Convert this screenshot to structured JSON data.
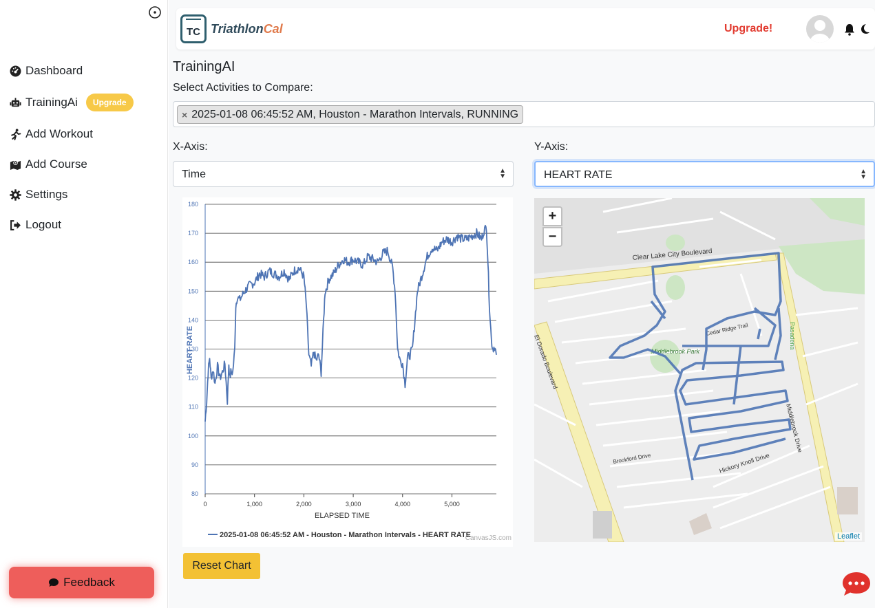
{
  "sidebar": {
    "items": [
      {
        "label": "Dashboard",
        "icon": "dashboard-icon"
      },
      {
        "label": "TrainingAi",
        "icon": "robot-icon",
        "badge": "Upgrade"
      },
      {
        "label": "Add Workout",
        "icon": "running-icon"
      },
      {
        "label": "Add Course",
        "icon": "map-icon"
      },
      {
        "label": "Settings",
        "icon": "gear-icon"
      },
      {
        "label": "Logout",
        "icon": "logout-icon"
      }
    ],
    "feedback_label": "Feedback"
  },
  "header": {
    "logo_mark": "TC",
    "logo_text_a": "Triathlon",
    "logo_text_b": "Cal",
    "upgrade_label": "Upgrade!"
  },
  "page": {
    "title": "TrainingAI",
    "select_label": "Select Activities to Compare:",
    "selected_activity": "2025-01-08 06:45:52 AM, Houston - Marathon Intervals, RUNNING",
    "xaxis_label": "X-Axis:",
    "xaxis_value": "Time",
    "yaxis_label": "Y-Axis:",
    "yaxis_value": "HEART RATE",
    "reset_label": "Reset Chart"
  },
  "map": {
    "zoom_in": "+",
    "zoom_out": "−",
    "attribution": "Leaflet",
    "street_labels": [
      "Clear Lake City Boulevard",
      "El Dorado Boulevard",
      "Middlebrook Drive",
      "Middlebrook Park",
      "Cedar Ridge Trail",
      "Hickory Knoll Drive",
      "Brookford Drive",
      "Pasadena"
    ]
  },
  "colors": {
    "accent": "#f7c948",
    "upgrade_red": "#e23b30",
    "series": "#4e74b4",
    "feedback": "#ee5e5b"
  },
  "chart_data": {
    "type": "line",
    "xlabel": "ELAPSED TIME",
    "ylabel": "HEART RATE",
    "xlim": [
      0,
      5900
    ],
    "ylim": [
      80,
      180
    ],
    "xticks": [
      0,
      1000,
      2000,
      3000,
      4000,
      5000
    ],
    "xtick_labels": [
      "0",
      "1,000",
      "2,000",
      "3,000",
      "4,000",
      "5,000"
    ],
    "yticks": [
      80,
      90,
      100,
      110,
      120,
      130,
      140,
      150,
      160,
      170,
      180
    ],
    "credit": "CanvasJS.com",
    "series": [
      {
        "name": "2025-01-08 06:45:52 AM - Houston - Marathon Intervals - HEART RATE",
        "x": [
          0,
          30,
          60,
          90,
          120,
          160,
          200,
          250,
          300,
          350,
          400,
          450,
          480,
          500,
          520,
          560,
          600,
          620,
          650,
          700,
          800,
          900,
          1000,
          1100,
          1200,
          1300,
          1400,
          1500,
          1600,
          1700,
          1800,
          1900,
          2000,
          2050,
          2100,
          2150,
          2200,
          2250,
          2300,
          2350,
          2400,
          2430,
          2460,
          2500,
          2550,
          2600,
          2700,
          2800,
          2900,
          3000,
          3100,
          3200,
          3300,
          3400,
          3500,
          3600,
          3700,
          3800,
          3850,
          3900,
          3950,
          4000,
          4050,
          4100,
          4150,
          4200,
          4250,
          4300,
          4350,
          4400,
          4500,
          4600,
          4700,
          4800,
          4900,
          5000,
          5100,
          5200,
          5300,
          5400,
          5500,
          5600,
          5650,
          5700,
          5730,
          5760,
          5800,
          5830,
          5860,
          5900
        ],
        "y": [
          105,
          112,
          122,
          127,
          120,
          123,
          118,
          124,
          120,
          122,
          125,
          112,
          125,
          120,
          122,
          122,
          130,
          145,
          148,
          147,
          150,
          152,
          153,
          156,
          155,
          157,
          156,
          155,
          157,
          154,
          157,
          158,
          155,
          145,
          128,
          124,
          129,
          126,
          128,
          122,
          140,
          150,
          151,
          154,
          155,
          156,
          159,
          161,
          160,
          161,
          160,
          159,
          162,
          161,
          160,
          163,
          164,
          158,
          150,
          130,
          126,
          125,
          118,
          127,
          128,
          130,
          140,
          150,
          153,
          156,
          162,
          165,
          164,
          167,
          168,
          167,
          169,
          168,
          168,
          169,
          170,
          168,
          171,
          172,
          160,
          145,
          133,
          130,
          131,
          128
        ]
      }
    ]
  }
}
